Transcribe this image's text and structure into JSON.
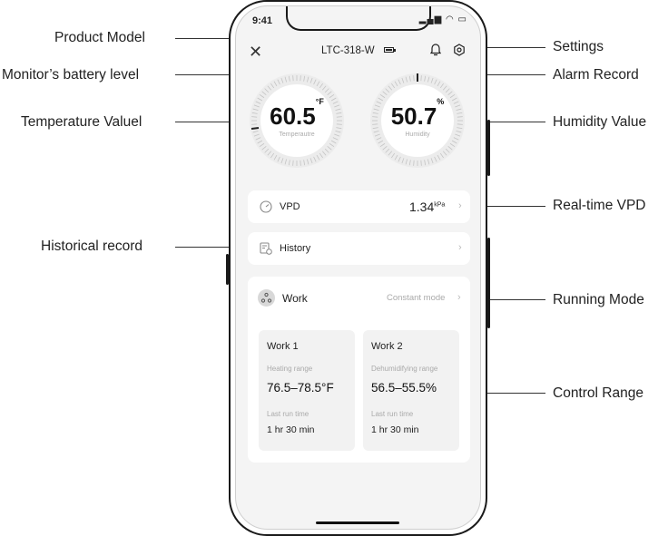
{
  "annotations": {
    "product_model": "Product Model",
    "battery_level": "Monitor’s battery level",
    "temperature_value": "Temperature Valuel",
    "historical_record": "Historical record",
    "settings": "Settings",
    "alarm_record": "Alarm Record",
    "humidity_value": "Humidity Value",
    "realtime_vpd": "Real-time VPD",
    "running_mode": "Running Mode",
    "control_range": "Control Range"
  },
  "status_bar": {
    "time": "9:41",
    "icons": "▂▄▆ ◠ ▭"
  },
  "top_bar": {
    "close_icon": "close-icon",
    "model": "LTC-318-W"
  },
  "gauges": {
    "temperature": {
      "value": "60.5",
      "unit": "°F",
      "label": "Temperautre"
    },
    "humidity": {
      "value": "50.7",
      "unit": "%",
      "label": "Humidity"
    }
  },
  "vpd": {
    "label": "VPD",
    "value": "1.34",
    "unit": "kPa"
  },
  "history": {
    "label": "History"
  },
  "work": {
    "label": "Work",
    "mode": "Constant mode",
    "items": [
      {
        "title": "Work 1",
        "range_label": "Heating range",
        "range": "76.5–78.5°F",
        "last_label": "Last run time",
        "last": "1 hr 30 min"
      },
      {
        "title": "Work 2",
        "range_label": "Dehumidifying range",
        "range": "56.5–55.5%",
        "last_label": "Last run time",
        "last": "1 hr 30 min"
      }
    ]
  },
  "chevron": "›"
}
